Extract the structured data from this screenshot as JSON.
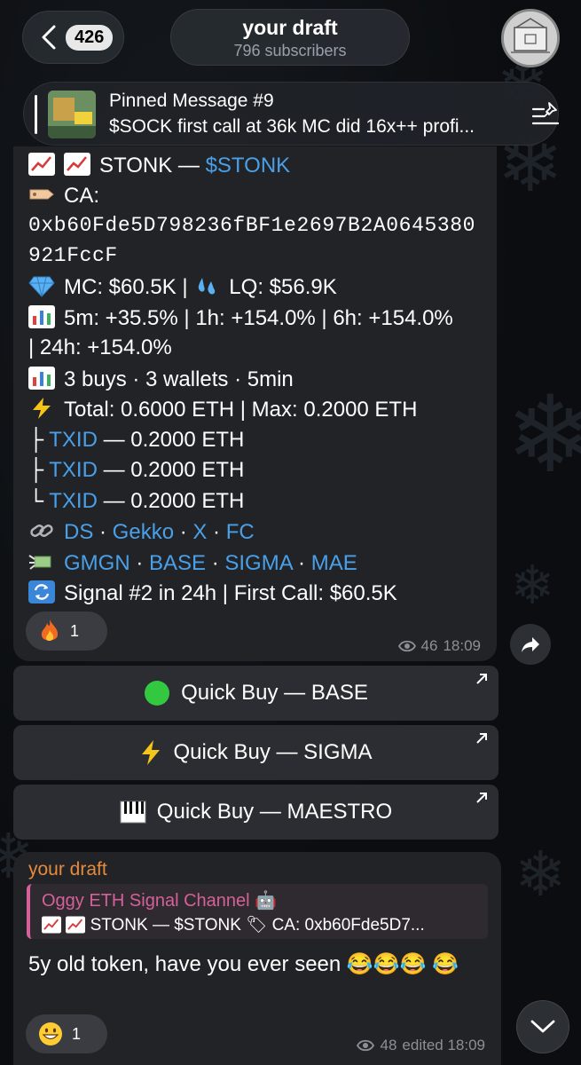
{
  "header": {
    "back_count": "426",
    "title": "your draft",
    "subtitle": "796 subscribers"
  },
  "pinned": {
    "title": "Pinned Message #9",
    "text": "$SOCK first call at 36k MC did 16x++ profi..."
  },
  "message1": {
    "line_token_name": "STONK — ",
    "line_token_ticker": "$STONK",
    "ca_label": "CA:",
    "ca_line1": "0xb60Fde5D798236fBF1e2697B2A0645380",
    "ca_line2": "921FccF",
    "mc_lq": "MC: $60.5K  |  ",
    "lq": "LQ: $56.9K",
    "changes_1": "5m: +35.5% | 1h: +154.0% | 6h: +154.0%",
    "changes_2": "| 24h: +154.0%",
    "buys": "3 buys · 3 wallets · 5min",
    "total": "Total: 0.6000 ETH  |  Max: 0.2000 ETH",
    "tx1_prefix": "├",
    "tx2_prefix": "├",
    "tx3_prefix": "└",
    "tx_link": "TXID",
    "tx_value": " — 0.2000 ETH",
    "links_1": [
      "DS",
      "Gekko",
      "X",
      "FC"
    ],
    "links_2": [
      "GMGN",
      "BASE",
      "SIGMA",
      "MAE"
    ],
    "sep": " · ",
    "signal": "Signal #2 in 24h  |  First Call: $60.5K",
    "reaction_count": "1",
    "views": "46",
    "time": "18:09"
  },
  "buttons": [
    {
      "label": "Quick Buy — BASE"
    },
    {
      "label": "Quick Buy — SIGMA"
    },
    {
      "label": "Quick Buy — MAESTRO"
    }
  ],
  "message2": {
    "author": "your draft",
    "quote_author": "Oggy ETH Signal Channel 🤖",
    "quote_text": "STONK — $STONK 🏷 CA: 0xb60Fde5D7...",
    "text": "5y old token, have you ever seen 😂😂😂 😂",
    "reaction_count": "1",
    "views": "48",
    "status": "edited 18:09"
  },
  "colors": {
    "link": "#4aa0e8",
    "author": "#e88a3c",
    "quote_accent": "#d6609a",
    "bubble": "#212327"
  }
}
